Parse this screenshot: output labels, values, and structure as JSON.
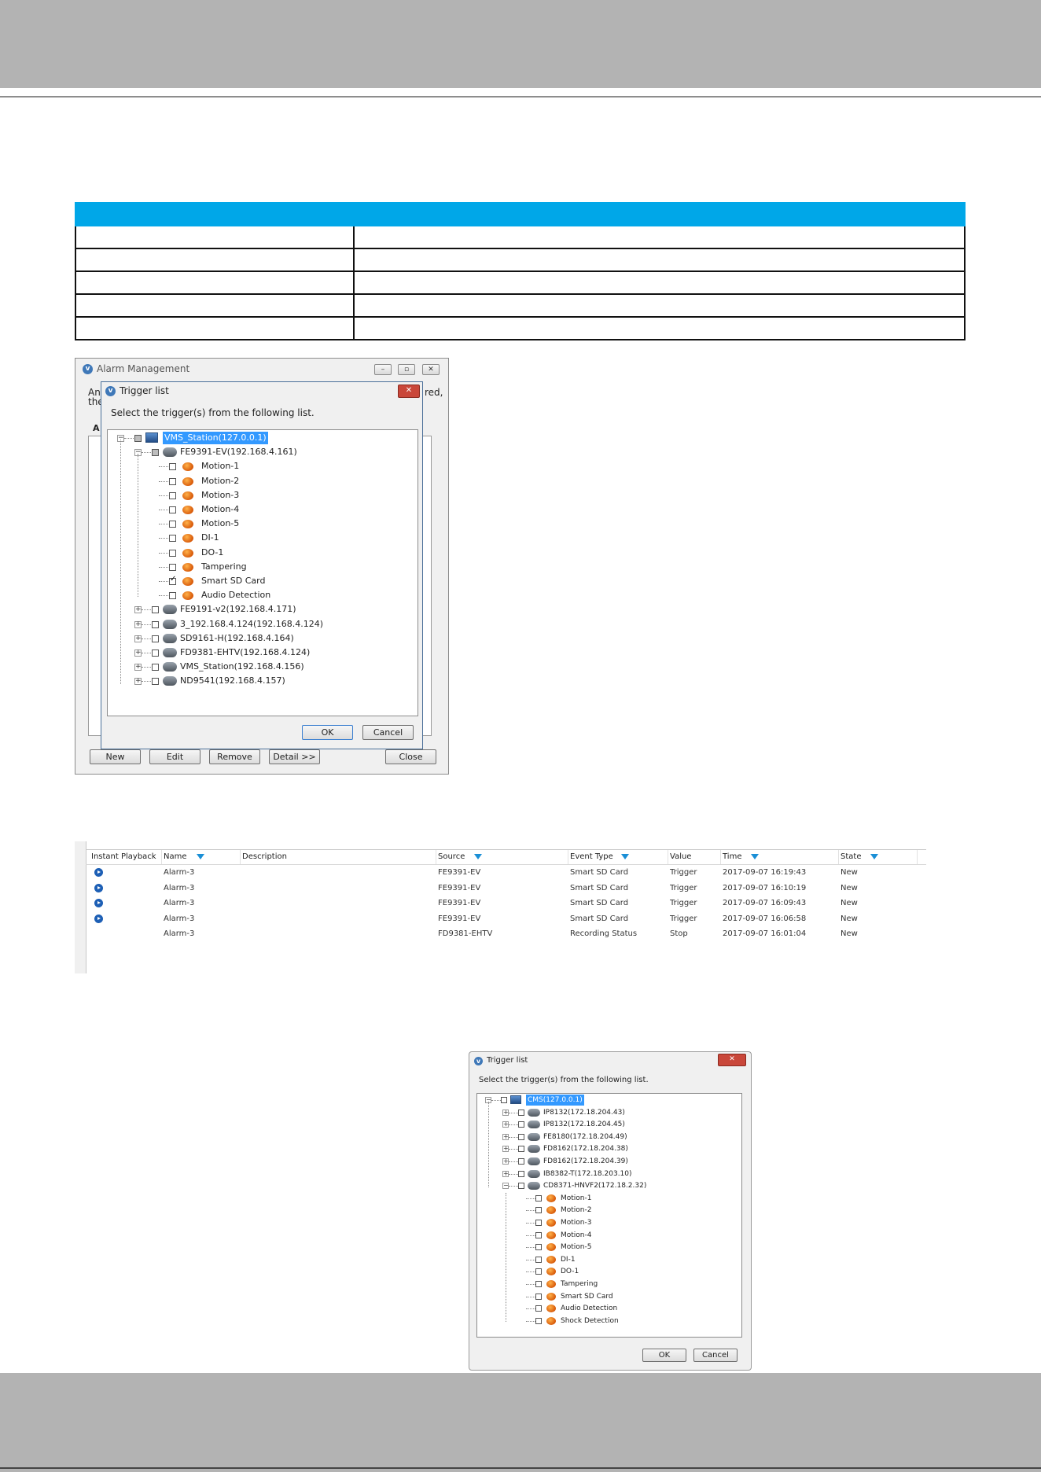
{
  "alarm_management": {
    "title": "Alarm Management",
    "bg_left_text": [
      "An",
      "the"
    ],
    "bg_right_text": "red,",
    "bg_tab": "A",
    "buttons": {
      "new": "New",
      "edit": "Edit",
      "remove": "Remove",
      "detail": "Detail >>",
      "close": "Close"
    }
  },
  "trigger_list_1": {
    "title": "Trigger list",
    "instruction": "Select the trigger(s) from the following list.",
    "root": "VMS_Station(127.0.0.1)",
    "camera": "FE9391-EV(192.168.4.161)",
    "events": [
      "Motion-1",
      "Motion-2",
      "Motion-3",
      "Motion-4",
      "Motion-5",
      "DI-1",
      "DO-1",
      "Tampering",
      "Smart SD Card",
      "Audio Detection"
    ],
    "checked_event_index": 8,
    "other_devices": [
      "FE9191-v2(192.168.4.171)",
      "3_192.168.4.124(192.168.4.124)",
      "SD9161-H(192.168.4.164)",
      "FD9381-EHTV(192.168.4.124)",
      "VMS_Station(192.168.4.156)",
      "ND9541(192.168.4.157)"
    ],
    "ok": "OK",
    "cancel": "Cancel"
  },
  "alarm_table": {
    "columns": [
      "Instant Playback",
      "Name",
      "Description",
      "Source",
      "Event Type",
      "Value",
      "Time",
      "State"
    ],
    "rows": [
      {
        "playback": true,
        "name": "Alarm-3",
        "description": "",
        "source": "FE9391-EV",
        "event_type": "Smart SD Card",
        "value": "Trigger",
        "time": "2017-09-07 16:19:43",
        "state": "New"
      },
      {
        "playback": true,
        "name": "Alarm-3",
        "description": "",
        "source": "FE9391-EV",
        "event_type": "Smart SD Card",
        "value": "Trigger",
        "time": "2017-09-07 16:10:19",
        "state": "New"
      },
      {
        "playback": true,
        "name": "Alarm-3",
        "description": "",
        "source": "FE9391-EV",
        "event_type": "Smart SD Card",
        "value": "Trigger",
        "time": "2017-09-07 16:09:43",
        "state": "New"
      },
      {
        "playback": true,
        "name": "Alarm-3",
        "description": "",
        "source": "FE9391-EV",
        "event_type": "Smart SD Card",
        "value": "Trigger",
        "time": "2017-09-07 16:06:58",
        "state": "New"
      },
      {
        "playback": false,
        "name": "Alarm-3",
        "description": "",
        "source": "FD9381-EHTV",
        "event_type": "Recording Status",
        "value": "Stop",
        "time": "2017-09-07 16:01:04",
        "state": "New"
      }
    ]
  },
  "trigger_list_2": {
    "title": "Trigger list",
    "instruction": "Select the trigger(s) from the following list.",
    "root": "CMS(127.0.0.1)",
    "devices": [
      "IP8132(172.18.204.43)",
      "IP8132(172.18.204.45)",
      "FE8180(172.18.204.49)",
      "FD8162(172.18.204.38)",
      "FD8162(172.18.204.39)",
      "IB8382-T(172.18.203.10)",
      "CD8371-HNVF2(172.18.2.32)"
    ],
    "events": [
      "Motion-1",
      "Motion-2",
      "Motion-3",
      "Motion-4",
      "Motion-5",
      "DI-1",
      "DO-1",
      "Tampering",
      "Smart SD Card",
      "Audio Detection",
      "Shock Detection"
    ],
    "ok": "OK",
    "cancel": "Cancel"
  },
  "colors": {
    "table_header": "#00a7e8",
    "band": "#b3b3b3",
    "selection": "#3399ff"
  }
}
